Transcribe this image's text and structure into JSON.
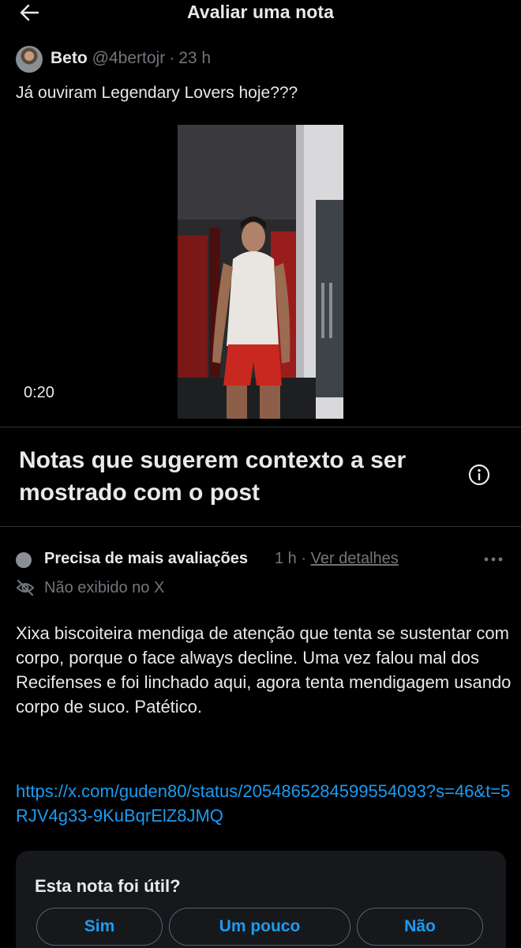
{
  "header": {
    "title": "Avaliar uma nota",
    "back_icon": "arrow-left-icon"
  },
  "post": {
    "author_name": "Beto",
    "handle": "@4bertojr",
    "separator": "·",
    "time": "23 h",
    "text": "Já ouviram Legendary Lovers hoje???",
    "video": {
      "duration": "0:20"
    }
  },
  "notes_section": {
    "title": "Notas que sugerem contexto a ser mostrado com o post",
    "info_icon": "info-icon"
  },
  "note": {
    "status": "Precisa de mais avaliações",
    "status_color": "#8b8f93",
    "time": "1 h",
    "separator": "·",
    "details_link": "Ver detalhes",
    "more_icon": "more-icon",
    "visibility": "Não exibido no X",
    "visibility_icon": "eye-off-icon",
    "body": "Xixa biscoiteira mendiga de atenção que tenta se sustentar com corpo, porque o face always decline. Uma vez falou mal dos Recifenses e foi linchado aqui, agora tenta mendigagem usando corpo de suco. Patético.",
    "link": "https://x.com/guden80/status/2054865284599554093?s=46&t=5RJV4g33-9KuBqrElZ8JMQ"
  },
  "rating": {
    "question": "Esta nota foi útil?",
    "options": [
      "Sim",
      "Um pouco",
      "Não"
    ]
  },
  "colors": {
    "background": "#000000",
    "text": "#e7e9ea",
    "muted": "#71767b",
    "link": "#1d9bf0",
    "card": "#16181c",
    "divider": "#2f3336"
  }
}
